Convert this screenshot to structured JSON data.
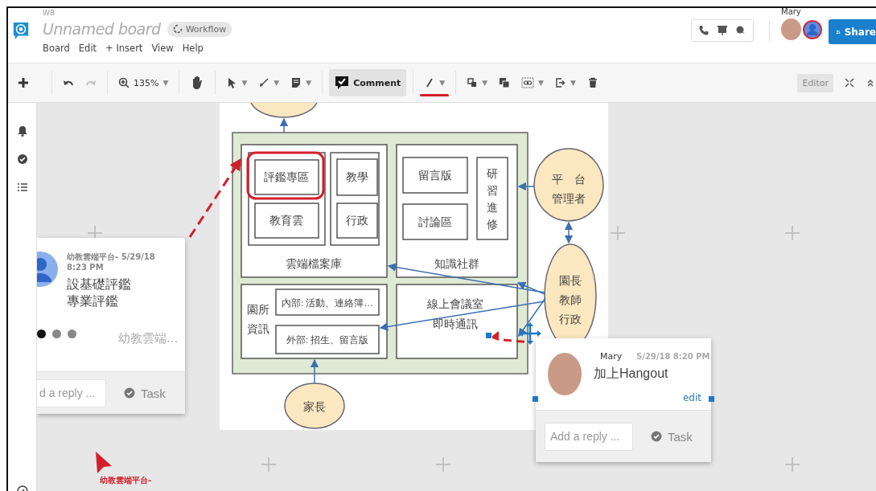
{
  "header": {
    "workspace": "WB",
    "board_title": "Unnamed board",
    "workflow_label": "Workflow",
    "menu": [
      "Board",
      "Edit",
      "+ Insert",
      "View",
      "Help"
    ],
    "user_name": "Mary",
    "share_label": "Share"
  },
  "toolbar": {
    "items": [
      {
        "kind": "add",
        "selected": false,
        "disabled": false
      },
      {
        "kind": "undo",
        "selected": false,
        "disabled": false
      },
      {
        "kind": "redo",
        "selected": false,
        "disabled": true
      },
      {
        "kind": "zoom",
        "label": "135%",
        "caret": "▼",
        "selected": false,
        "disabled": false
      },
      {
        "kind": "hand",
        "selected": false,
        "disabled": false
      },
      {
        "kind": "pointer",
        "caret": "▼",
        "selected": false,
        "disabled": false
      },
      {
        "kind": "connector",
        "caret": "▼",
        "selected": false,
        "disabled": false
      },
      {
        "kind": "note",
        "caret": "▼",
        "selected": false,
        "disabled": false
      },
      {
        "kind": "comment",
        "label": "Comment",
        "selected": true,
        "disabled": false
      },
      {
        "kind": "pen",
        "caret": "▼",
        "selected": true,
        "disabled": false
      },
      {
        "kind": "shapes",
        "caret": "▼",
        "selected": false,
        "disabled": false
      },
      {
        "kind": "copy",
        "selected": false,
        "disabled": false
      },
      {
        "kind": "link",
        "caret": "▼",
        "selected": false,
        "disabled": false
      },
      {
        "kind": "export",
        "caret": "▼",
        "selected": false,
        "disabled": false
      },
      {
        "kind": "delete",
        "selected": false,
        "disabled": false
      }
    ],
    "mode_label": "Editor"
  },
  "diagram": {
    "cloud_library": {
      "title": "雲端檔案庫",
      "items": [
        "評鑑專區",
        "教育雲",
        "教學",
        "行政"
      ]
    },
    "community": {
      "title": "知識社群",
      "items": [
        "留言版",
        "討論區"
      ],
      "vertical_item": "研習進修"
    },
    "school_info": {
      "title_lines": [
        "園所",
        "資訊"
      ],
      "items": [
        "內部: 活動、連絡簿…",
        "外部: 招生、留言版"
      ]
    },
    "meeting": {
      "lines": [
        "線上會議室",
        "即時通訊"
      ]
    },
    "admin_node": {
      "lines": [
        "平　台",
        "管理者"
      ]
    },
    "staff_node": {
      "lines": [
        "園長",
        "教師",
        "行政"
      ]
    },
    "parents_node": {
      "label": "家長"
    }
  },
  "comment_left": {
    "meta": "幼教雲端平台- 5/29/18 8:23 PM",
    "lines": [
      "設基礎評鑑",
      "專業評鑑"
    ],
    "dots": [
      {
        "selected": true
      },
      {
        "selected": false
      },
      {
        "selected": false
      }
    ],
    "source": "幼教雲端...",
    "reply_placeholder": "d a reply ...",
    "task_label": "Task"
  },
  "comment_right": {
    "author": "Mary",
    "time": "5/29/18 8:20 PM",
    "text": "加上Hangout",
    "edit_label": "edit",
    "reply_placeholder": "Add a reply ...",
    "task_label": "Task"
  },
  "cursor_label": "幼教雲端平台-"
}
